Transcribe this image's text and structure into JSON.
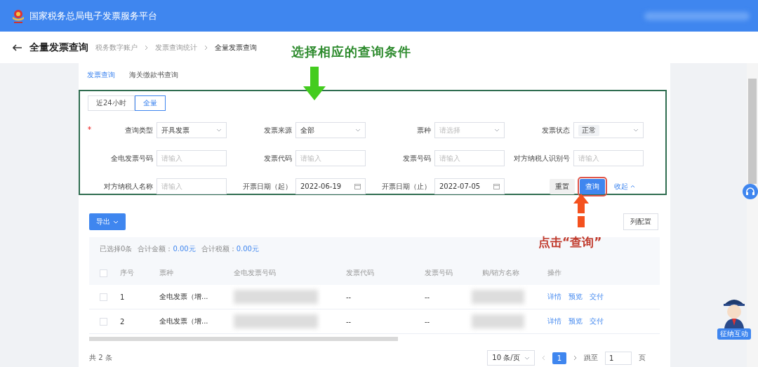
{
  "header": {
    "title": "国家税务总局电子发票服务平台"
  },
  "page": {
    "title": "全量发票查询",
    "breadcrumb": [
      "税务数字账户",
      "发票查询统计",
      "全量发票查询"
    ]
  },
  "tabs": [
    {
      "label": "发票查询",
      "selected": true
    },
    {
      "label": "海关缴款书查询",
      "selected": false
    }
  ],
  "range": [
    {
      "label": "近24小时",
      "selected": false
    },
    {
      "label": "全量",
      "selected": true
    }
  ],
  "filters": [
    {
      "kind": "select",
      "label": "查询类型",
      "required": true,
      "value": "开具发票"
    },
    {
      "kind": "select",
      "label": "发票来源",
      "required": false,
      "value": "全部"
    },
    {
      "kind": "select",
      "label": "票种",
      "required": false,
      "placeholder": "请选择"
    },
    {
      "kind": "tags",
      "label": "发票状态",
      "required": false,
      "tags": [
        "正常"
      ]
    },
    {
      "kind": "input",
      "label": "全电发票号码",
      "required": false,
      "placeholder": "请输入"
    },
    {
      "kind": "input",
      "label": "发票代码",
      "required": false,
      "placeholder": "请输入"
    },
    {
      "kind": "input",
      "label": "发票号码",
      "required": false,
      "placeholder": "请输入"
    },
    {
      "kind": "input",
      "label": "对方纳税人识别号",
      "required": false,
      "placeholder": "请输入"
    },
    {
      "kind": "input",
      "label": "对方纳税人名称",
      "required": false,
      "placeholder": "请输入"
    },
    {
      "kind": "date",
      "label": "开票日期（起）",
      "required": false,
      "value": "2022-06-19"
    },
    {
      "kind": "date",
      "label": "开票日期（止）",
      "required": false,
      "value": "2022-07-05"
    }
  ],
  "filter_actions": {
    "reset": "重置",
    "search": "查询",
    "collapse": "收起"
  },
  "annotations": {
    "select_hint": "选择相应的查询条件",
    "click_hint": "点击“查询”"
  },
  "toolbar": {
    "export": "导出",
    "columns": "列配置"
  },
  "summary": {
    "selected": "已选择0条",
    "amount_label": "合计金额：",
    "amount": "0.00元",
    "tax_label": "合计税额：",
    "tax": "0.00元"
  },
  "table": {
    "columns": [
      "序号",
      "票种",
      "全电发票号码",
      "发票代码",
      "发票号码",
      "购/销方名称",
      "操作"
    ],
    "header_checked": false,
    "rows": [
      {
        "cells": [
          "1",
          "全电发票（增...",
          "",
          "--",
          "--",
          ""
        ],
        "checked": false,
        "actions": [
          "详情",
          "预览",
          "交付"
        ]
      },
      {
        "cells": [
          "2",
          "全电发票（增...",
          "",
          "--",
          "--",
          ""
        ],
        "checked": false,
        "actions": [
          "详情",
          "预览",
          "交付"
        ]
      }
    ]
  },
  "pagination": {
    "total": "共 2 条",
    "page_size": "10 条/页",
    "pages": [
      {
        "label": "1",
        "selected": true
      }
    ],
    "jump_label": "跳至",
    "jump_value": "1",
    "page_unit": "页"
  },
  "assistant": {
    "label": "征纳互动"
  }
}
